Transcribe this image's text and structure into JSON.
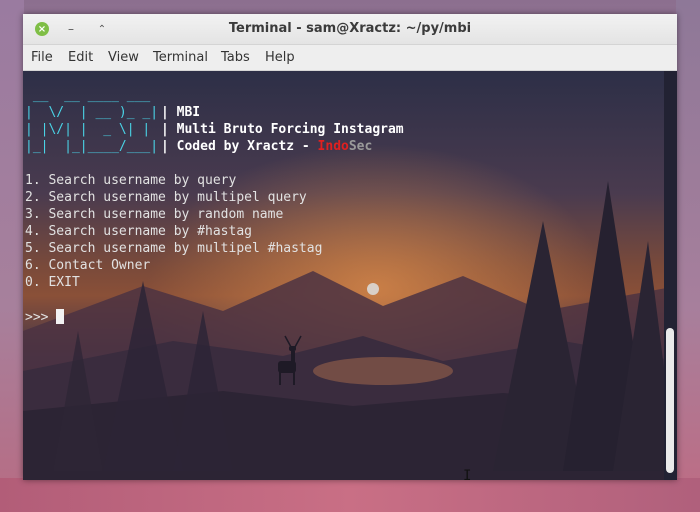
{
  "window": {
    "title": "Terminal - sam@Xractz: ~/py/mbi",
    "buttons": {
      "close": "×",
      "minimize": "–",
      "maximize": "⌃"
    }
  },
  "menu": [
    "File",
    "Edit",
    "View",
    "Terminal",
    "Tabs",
    "Help"
  ],
  "terminal": {
    "banner": [
      " __  __ ____ ___ ",
      "|  \\/  | __ )_ _|",
      "| |\\/| |  _ \\| | ",
      "|_|  |_|____/___|"
    ],
    "header_lines": [
      "MBI",
      "Multi Bruto Forcing Instagram",
      "Coded by Xractz - "
    ],
    "brand_indo": "Indo",
    "brand_sec": "Sec",
    "options": [
      "1. Search username by query",
      "2. Search username by multipel query",
      "3. Search username by random name",
      "4. Search username by #hastag",
      "5. Search username by multipel #hastag",
      "6. Contact Owner",
      "0. EXIT"
    ],
    "prompt": ">>> "
  },
  "colors": {
    "banner": "#4ad3e6",
    "indo": "#e02020",
    "sec": "#9a9a9a",
    "close_button": "#7fbe46"
  }
}
